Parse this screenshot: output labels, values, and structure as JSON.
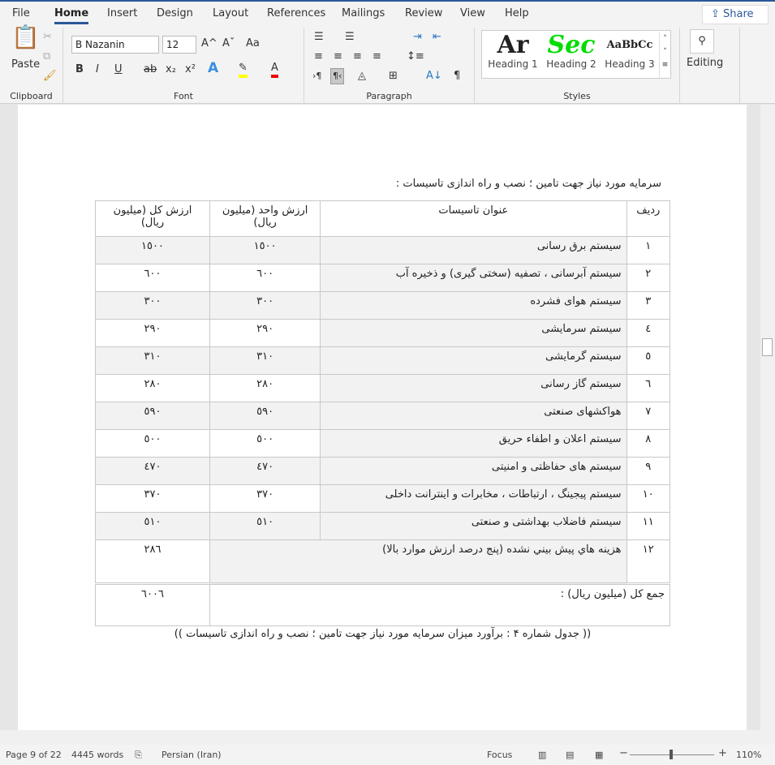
{
  "menu": {
    "tabs": [
      "File",
      "Home",
      "Insert",
      "Design",
      "Layout",
      "References",
      "Mailings",
      "Review",
      "View",
      "Help"
    ],
    "active": "Home",
    "share": "Share"
  },
  "ribbon": {
    "clipboard": {
      "label": "Clipboard",
      "paste": "Paste"
    },
    "font": {
      "label": "Font",
      "name": "B Nazanin",
      "size": "12",
      "grow": "A^",
      "shrink": "Aˇ",
      "case": "Aa",
      "bold": "B",
      "italic": "I",
      "underline": "U",
      "strike": "ab",
      "sub": "x₂",
      "sup": "x²",
      "highlight_color": "#ffff00",
      "font_color": "#e00000"
    },
    "paragraph": {
      "label": "Paragraph",
      "pilcrow": "¶"
    },
    "styles": {
      "label": "Styles",
      "items": [
        {
          "preview": "Ar",
          "name": "Heading 1",
          "color": "#000000"
        },
        {
          "preview": "Sec",
          "name": "Heading 2",
          "color": "#00dd00"
        },
        {
          "preview": "AaBbCc",
          "name": "Heading 3",
          "color": "#000000"
        }
      ]
    },
    "editing": {
      "label": "Editing"
    }
  },
  "document": {
    "heading": "سرمایه مورد نیاز جهت تامین ؛ نصب و راه اندازی تاسیسات :",
    "table": {
      "headers": [
        "ردیف",
        "عنوان تاسیسات",
        "ارزش واحد (میلیون ریال)",
        "ارزش کل (میلیون ریال)"
      ],
      "rows": [
        [
          "١",
          "سیستم برق رسانی",
          "١٥٠٠",
          "١٥٠٠"
        ],
        [
          "٢",
          "سیستم آبرسانی ، تصفیه (سختی گیری) و ذخیره آب",
          "٦٠٠",
          "٦٠٠"
        ],
        [
          "٣",
          "سیستم هوای فشرده",
          "٣٠٠",
          "٣٠٠"
        ],
        [
          "٤",
          "سیستم سرمایشی",
          "٢٩٠",
          "٢٩٠"
        ],
        [
          "٥",
          "سیستم گرمایشی",
          "٣١٠",
          "٣١٠"
        ],
        [
          "٦",
          "سیستم گاز رسانی",
          "٢٨٠",
          "٢٨٠"
        ],
        [
          "٧",
          "هواکشهای صنعتی",
          "٥٩٠",
          "٥٩٠"
        ],
        [
          "٨",
          "سیستم اعلان و اطفاء حریق",
          "٥٠٠",
          "٥٠٠"
        ],
        [
          "٩",
          "سیستم های حفاظتی و امنیتی",
          "٤٧٠",
          "٤٧٠"
        ],
        [
          "١٠",
          "سیستم پیجینگ ، ارتباطات ، مخابرات و اینترانت داخلی",
          "٣٧٠",
          "٣٧٠"
        ],
        [
          "١١",
          "سیستم فاضلاب بهداشتی و صنعتی",
          "٥١٠",
          "٥١٠"
        ]
      ],
      "row12": [
        "١٢",
        "هزينه هاي پيش بيني نشده (پنج درصد ارزش موارد بالا)",
        "٢٨٦"
      ],
      "total": {
        "label": "جمع کل (میلیون ریال) :",
        "value": "٦٠٠٦"
      }
    },
    "caption": "(( جدول شماره ۴ : برآورد میزان سرمایه مورد نیاز جهت تامین ؛ نصب و راه اندازی تاسیسات ))"
  },
  "status": {
    "page": "Page 9 of 22",
    "words": "4445 words",
    "language": "Persian (Iran)",
    "focus": "Focus",
    "zoom": "110%",
    "zoom_level_percent": 110
  }
}
